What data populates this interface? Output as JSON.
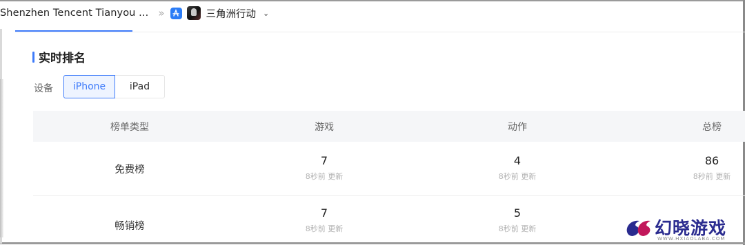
{
  "breadcrumb": {
    "developer": "Shenzhen Tencent Tianyou ...",
    "separator": "»",
    "app_name": "三角洲行动"
  },
  "section": {
    "title": "实时排名"
  },
  "device": {
    "label": "设备",
    "options": [
      "iPhone",
      "iPad"
    ],
    "selected": "iPhone"
  },
  "table": {
    "headers": [
      "榜单类型",
      "游戏",
      "动作",
      "总榜"
    ],
    "rows": [
      {
        "name": "免费榜",
        "cells": [
          {
            "rank": "7",
            "updated": "8秒前 更新"
          },
          {
            "rank": "4",
            "updated": "8秒前 更新"
          },
          {
            "rank": "86",
            "updated": "8秒前 更新"
          }
        ]
      },
      {
        "name": "畅销榜",
        "cells": [
          {
            "rank": "7",
            "updated": "8秒前 更新"
          },
          {
            "rank": "5",
            "updated": "8秒前 更新"
          }
        ]
      }
    ]
  },
  "watermark": {
    "text": "幻晓游戏",
    "sub": "WWW.HXIAOLABA.COM"
  },
  "colors": {
    "accent": "#3e7bfa",
    "header_bg": "#f5f6f8",
    "muted_text": "#b3b3b3"
  }
}
